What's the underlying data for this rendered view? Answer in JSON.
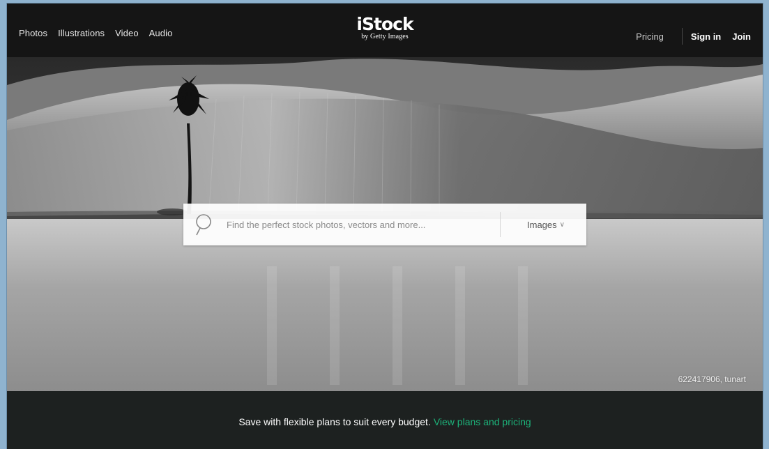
{
  "nav": {
    "left_items": [
      "Photos",
      "Illustrations",
      "Video",
      "Audio"
    ],
    "logo_main": "iStock",
    "logo_sub": "by Getty Images",
    "pricing": "Pricing",
    "sign_in": "Sign in",
    "join": "Join"
  },
  "search": {
    "placeholder": "Find the perfect stock photos, vectors and more...",
    "type_label": "Images",
    "icon": "search-icon"
  },
  "hero": {
    "credit": "622417906, tunart"
  },
  "promo": {
    "text": "Save with flexible plans to suit every budget.",
    "link": "View plans and pricing",
    "link_color": "#1db37a"
  },
  "colors": {
    "nav_bg": "#151515",
    "promo_bg": "#1d2120",
    "accent": "#1db37a"
  }
}
